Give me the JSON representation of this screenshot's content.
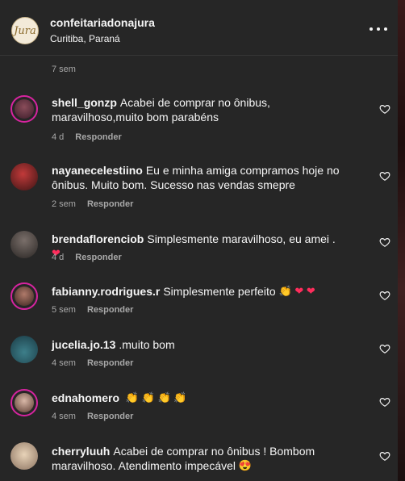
{
  "header": {
    "avatar_text": "Jura",
    "username": "confeitariadonajura",
    "location": "Curitiba, Paraná"
  },
  "top_timestamp": "7 sem",
  "reply_label": "Responder",
  "comments": [
    {
      "user": "shell_gonzp",
      "text": "Acabei de comprar no ônibus, maravilhoso,muito bom parabéns",
      "time": "4 d"
    },
    {
      "user": "nayanecelestiino",
      "text": "Eu e minha amiga compramos hoje no ônibus. Muito bom. Sucesso nas vendas smepre",
      "time": "2 sem"
    },
    {
      "user": "brendaflorenciob",
      "text": "Simplesmente maravilhoso, eu amei .",
      "emoji": "❤",
      "time": "4 d"
    },
    {
      "user": "fabianny.rodrigues.r",
      "text": "Simplesmente perfeito",
      "emoji": "👏 ❤ ❤",
      "time": "5 sem"
    },
    {
      "user": "jucelia.jo.13",
      "text": ".muito bom",
      "time": "4 sem"
    },
    {
      "user": "ednahomero",
      "text": "",
      "emoji": "👏 👏 👏 👏",
      "time": "4 sem"
    },
    {
      "user": "cherryluuh",
      "text": "Acabei de comprar no ônibus ! Bombom maravilhoso. Atendimento impecável",
      "emoji": "😍",
      "time": ""
    }
  ],
  "colors": {
    "background": "#262626",
    "meta_text": "#a8a8a8",
    "story_ring": "#d6249f"
  }
}
